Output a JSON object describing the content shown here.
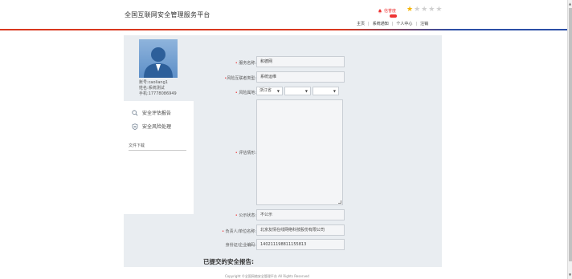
{
  "header": {
    "site_title": "全国互联网安全管理服务平台",
    "alert_label": "信誉度",
    "stars_filled": 1,
    "stars_total": 5,
    "nav": [
      "主页",
      "系统通知",
      "个人中心",
      "注销"
    ]
  },
  "user": {
    "account_label": "账号:",
    "account": "caoliang1",
    "name_label": "姓名:",
    "name": "系统测试",
    "phone_label": "手机:",
    "phone": "17778086949"
  },
  "sidebar": {
    "items": [
      {
        "label": "安全评估报告",
        "icon": "search-icon"
      },
      {
        "label": "安全风险处理",
        "icon": "shield-icon"
      }
    ],
    "file_download": "文件下载"
  },
  "form": {
    "service_name_label": "服务名称:",
    "service_name": "和德网",
    "risk_type_label": "风险互联者类型:",
    "risk_type": "系统运维",
    "region_label": "风险属地:",
    "region_province": "浙江省",
    "region_city": "",
    "region_district": "",
    "description_label": "评估情形:",
    "description": "",
    "public_status_label": "公示状态:",
    "public_status": "不公示",
    "owner_label": "负责人/单位名称:",
    "owner": "北京友情在线网络科技股份有限公司",
    "id_label": "身份证/企业编码:",
    "id_value": "140211198811155813"
  },
  "submitted_title": "已提交的安全报告:",
  "footer": "Copyright ©全国网络安全管理平台 All Rights Reserved",
  "colors": {
    "accent_red": "#d9381e",
    "accent_blue": "#2b4ea6",
    "star_gold": "#f5b400"
  }
}
